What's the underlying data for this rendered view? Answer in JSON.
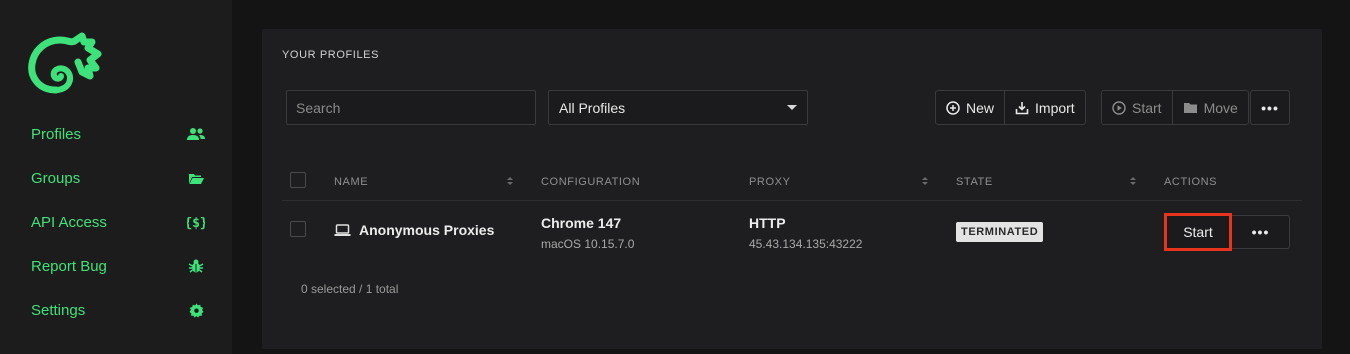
{
  "sidebar": {
    "logo_icon": "chameleon-logo-icon",
    "accent": "#3ee27a",
    "items": [
      {
        "label": "Profiles",
        "icon": "users-icon"
      },
      {
        "label": "Groups",
        "icon": "folder-open-icon"
      },
      {
        "label": "API Access",
        "icon": "code-braces-icon"
      },
      {
        "label": "Report Bug",
        "icon": "bug-icon"
      },
      {
        "label": "Settings",
        "icon": "gear-icon"
      }
    ]
  },
  "panel": {
    "title": "YOUR PROFILES",
    "search_placeholder": "Search",
    "filter_value": "All Profiles",
    "toolbar": {
      "new_label": "New",
      "import_label": "Import",
      "start_label": "Start",
      "move_label": "Move"
    },
    "columns": [
      "NAME",
      "CONFIGURATION",
      "PROXY",
      "STATE",
      "ACTIONS"
    ],
    "rows": [
      {
        "name": "Anonymous Proxies",
        "browser": "Chrome 147",
        "os": "macOS 10.15.7.0",
        "proxy_type": "HTTP",
        "proxy_address": "45.43.134.135:43222",
        "state": "TERMINATED",
        "action_label": "Start"
      }
    ],
    "footer": "0 selected / 1 total"
  }
}
